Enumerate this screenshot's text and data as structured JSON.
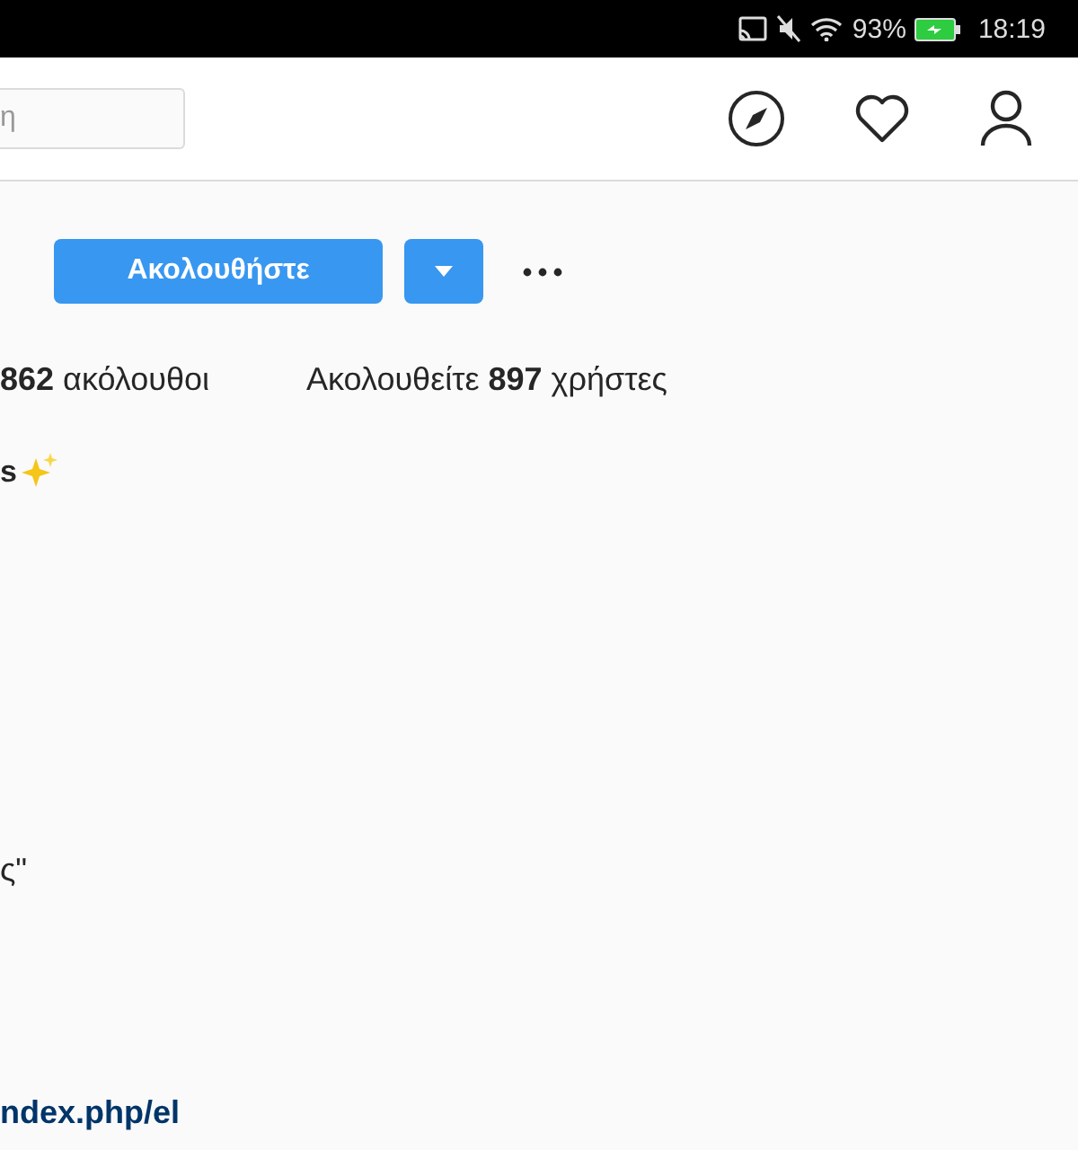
{
  "status_bar": {
    "battery": "93%",
    "time": "18:19"
  },
  "nav": {
    "search": {
      "placeholder": "η"
    }
  },
  "profile": {
    "follow_button": "Ακολουθήστε",
    "stats": [
      {
        "text": "**862** ακόλουθοι"
      },
      {
        "text": "Ακολουθείτε **897** χρήστες"
      }
    ],
    "name": "s",
    "bio": "ς\"",
    "link": "ndex.php/el"
  }
}
